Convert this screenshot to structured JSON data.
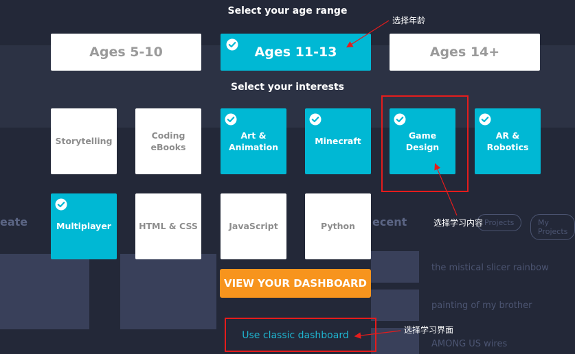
{
  "headings": {
    "age_range": "Select your age range",
    "interests": "Select your interests"
  },
  "age_options": [
    {
      "label": "Ages 5-10",
      "selected": false
    },
    {
      "label": "Ages 11-13",
      "selected": true
    },
    {
      "label": "Ages 14+",
      "selected": false
    }
  ],
  "interests": [
    {
      "label": "Storytelling",
      "selected": false
    },
    {
      "label": "Coding eBooks",
      "selected": false
    },
    {
      "label": "Art & Animation",
      "selected": true
    },
    {
      "label": "Minecraft",
      "selected": true
    },
    {
      "label": "Game Design",
      "selected": true
    },
    {
      "label": "AR & Robotics",
      "selected": true
    },
    {
      "label": "Multiplayer",
      "selected": true
    },
    {
      "label": "HTML & CSS",
      "selected": false
    },
    {
      "label": "JavaScript",
      "selected": false
    },
    {
      "label": "Python",
      "selected": false
    }
  ],
  "buttons": {
    "dashboard": "VIEW YOUR DASHBOARD",
    "classic": "Use classic dashboard"
  },
  "annotations": {
    "age": "选择年龄",
    "content": "选择学习内容",
    "interface": "选择学习界面"
  },
  "background": {
    "section_create": "eate",
    "section_recent": "ecent",
    "pill_projects": "Projects",
    "pill_other": "My Projects",
    "recent_items": [
      "the mistical slicer rainbow",
      "painting of my brother",
      "AMONG US wires"
    ]
  },
  "colors": {
    "selected": "#00b8d4",
    "accent": "#f7941d",
    "annotation": "#e51c1c",
    "background": "#232838"
  }
}
